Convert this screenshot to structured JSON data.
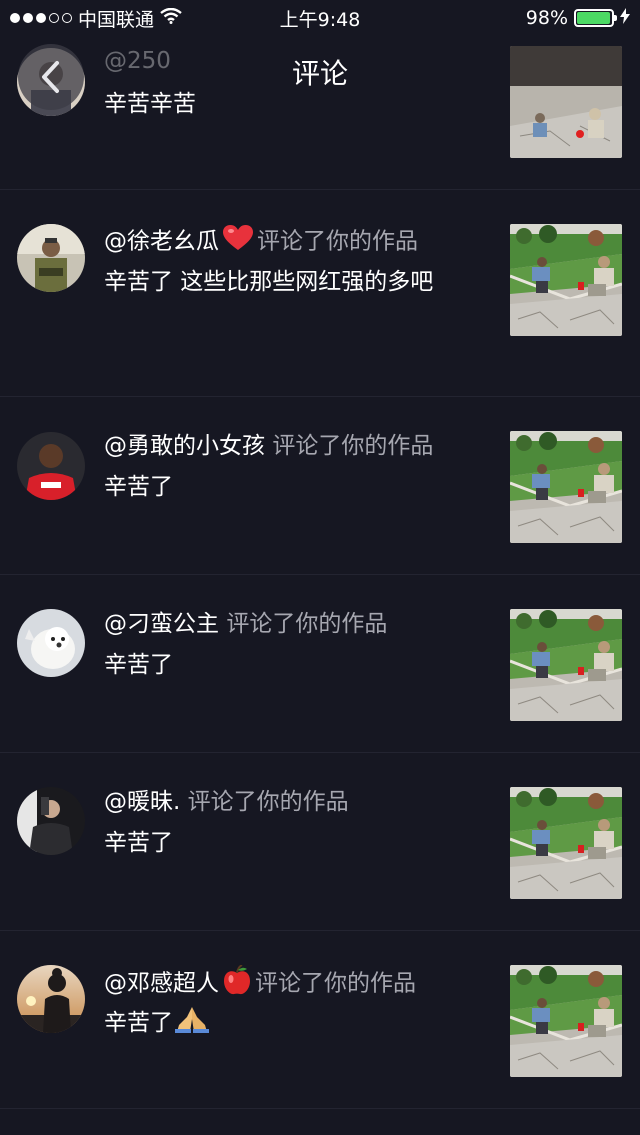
{
  "status_bar": {
    "carrier": "中国联通",
    "time": "上午9:48",
    "battery_percent": "98%",
    "battery_level": 0.98
  },
  "nav": {
    "title": "评论"
  },
  "comments": [
    {
      "user": "@250",
      "action": "",
      "text": "辛苦辛苦"
    },
    {
      "user": "@徐老幺瓜",
      "action": "评论了你的作品",
      "text": "辛苦了  这些比那些网红强的多吧",
      "emoji": "heart-icon"
    },
    {
      "user": "@勇敢的小女孩",
      "action": "评论了你的作品",
      "text": "辛苦了"
    },
    {
      "user": "@刁蛮公主",
      "action": "评论了你的作品",
      "text": "辛苦了"
    },
    {
      "user": "@暖昧.",
      "action": "评论了你的作品",
      "text": "辛苦了"
    },
    {
      "user": "@邓感超人",
      "action": "评论了你的作品",
      "text": "辛苦了",
      "emoji": "apple-icon",
      "text_emoji": "praying-hands-icon"
    }
  ],
  "colors": {
    "background": "#161722",
    "secondary_text": "#a6a7b0",
    "battery": "#4cd964"
  }
}
